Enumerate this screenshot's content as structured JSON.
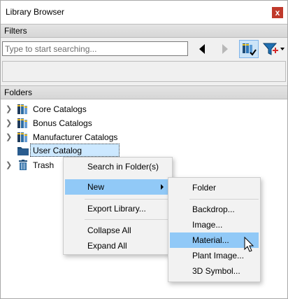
{
  "window": {
    "title": "Library Browser",
    "close_glyph": "x"
  },
  "filters": {
    "header": "Filters",
    "search_placeholder": "Type to start searching...",
    "icons": {
      "prev": "previous-icon",
      "next": "next-icon",
      "view": "catalog-view-icon",
      "filter": "filter-add-icon"
    }
  },
  "folders": {
    "header": "Folders",
    "items": [
      {
        "label": "Core Catalogs",
        "icon": "catalog-books-icon"
      },
      {
        "label": "Bonus Catalogs",
        "icon": "catalog-books-icon"
      },
      {
        "label": "Manufacturer Catalogs",
        "icon": "catalog-books-icon"
      },
      {
        "label": "User Catalog",
        "icon": "folder-icon"
      },
      {
        "label": "Trash",
        "icon": "trash-icon"
      }
    ]
  },
  "context_menu": {
    "search_in_folders": "Search in Folder(s)",
    "new": "New",
    "export_library": "Export Library...",
    "collapse_all": "Collapse All",
    "expand_all": "Expand All"
  },
  "new_submenu": {
    "folder": "Folder",
    "backdrop": "Backdrop...",
    "image": "Image...",
    "material": "Material...",
    "plant_image": "Plant Image...",
    "symbol_3d": "3D Symbol..."
  },
  "colors": {
    "header_bg": "#dcdcdc",
    "selection": "#cce8ff",
    "menu_highlight": "#91c9f7",
    "close_red": "#c0392b"
  }
}
